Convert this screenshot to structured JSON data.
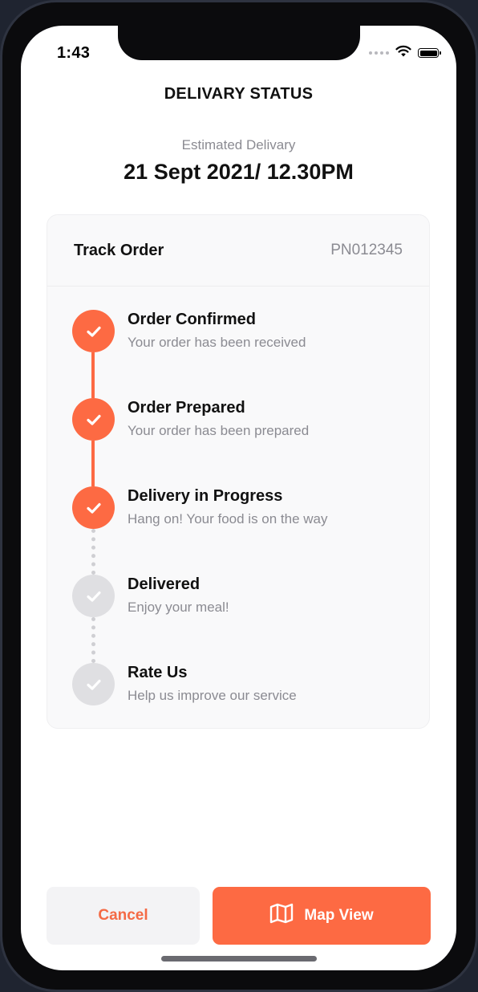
{
  "status_bar": {
    "time": "1:43",
    "icons": [
      "signal-icon",
      "wifi-icon",
      "battery-icon"
    ],
    "battery_level": 1.0
  },
  "header": {
    "title": "DELIVARY STATUS"
  },
  "estimate": {
    "label": "Estimated Delivary",
    "value": "21 Sept 2021/ 12.30PM"
  },
  "track": {
    "title": "Track Order",
    "order_id": "PN012345",
    "steps": [
      {
        "title": "Order Confirmed",
        "subtitle": "Your order has been received",
        "status": "done",
        "icon": "check-icon"
      },
      {
        "title": "Order Prepared",
        "subtitle": "Your order has been prepared",
        "status": "done",
        "icon": "check-icon"
      },
      {
        "title": "Delivery in Progress",
        "subtitle": "Hang on! Your food is on the way",
        "status": "done",
        "icon": "check-icon"
      },
      {
        "title": "Delivered",
        "subtitle": "Enjoy your meal!",
        "status": "pending",
        "icon": "check-icon"
      },
      {
        "title": "Rate Us",
        "subtitle": "Help us improve our service",
        "status": "pending",
        "icon": "check-icon"
      }
    ]
  },
  "actions": {
    "cancel_label": "Cancel",
    "map_label": "Map View",
    "map_icon": "map-icon"
  },
  "colors": {
    "accent": "#FD6A43",
    "cancel_text": "#F46A45",
    "pending": "#DFDFE2",
    "muted_text": "#8B8B92"
  }
}
